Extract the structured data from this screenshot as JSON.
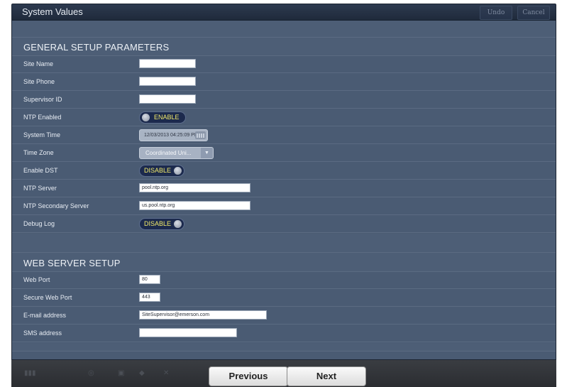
{
  "window": {
    "title": "System Values",
    "undo_label": "Undo",
    "cancel_label": "Cancel"
  },
  "general": {
    "section_title": "GENERAL SETUP PARAMETERS",
    "site_name": {
      "label": "Site Name",
      "value": ""
    },
    "site_phone": {
      "label": "Site Phone",
      "value": ""
    },
    "supervisor_id": {
      "label": "Supervisor ID",
      "value": ""
    },
    "ntp_enabled": {
      "label": "NTP Enabled",
      "state": "ENABLE"
    },
    "system_time": {
      "label": "System Time",
      "value": "12/03/2013 04:25:09 PM"
    },
    "time_zone": {
      "label": "Time Zone",
      "value": "Coordinated Uni..."
    },
    "enable_dst": {
      "label": "Enable DST",
      "state": "DISABLE"
    },
    "ntp_server": {
      "label": "NTP Server",
      "value": "pool.ntp.org"
    },
    "ntp_secondary": {
      "label": "NTP Secondary Server",
      "value": "us.pool.ntp.org"
    },
    "debug_log": {
      "label": "Debug Log",
      "state": "DISABLE"
    }
  },
  "web": {
    "section_title": "WEB SERVER SETUP",
    "web_port": {
      "label": "Web Port",
      "value": "80"
    },
    "secure_web_port": {
      "label": "Secure Web Port",
      "value": "443"
    },
    "email": {
      "label": "E-mail address",
      "value": "SiteSupervisor@emerson.com"
    },
    "sms": {
      "label": "SMS address",
      "value": ""
    }
  },
  "footer": {
    "previous_label": "Previous",
    "next_label": "Next"
  },
  "colors": {
    "panel": "#4a5b73",
    "toggle_bg": "#1c2a4d",
    "toggle_text": "#f1e96a"
  }
}
